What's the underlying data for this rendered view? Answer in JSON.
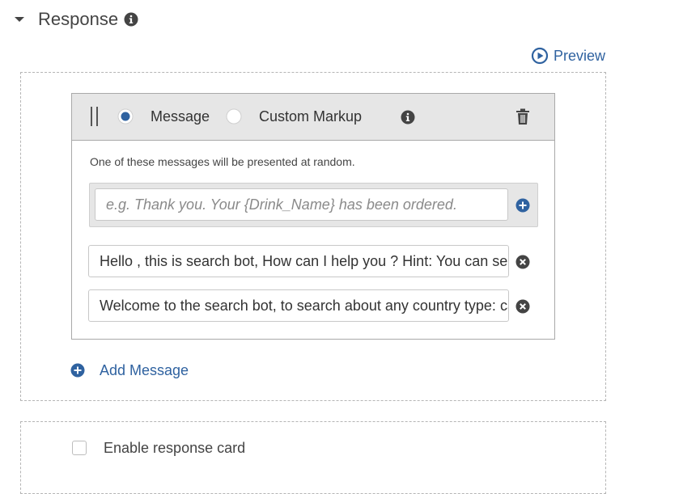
{
  "section": {
    "title": "Response",
    "preview_label": "Preview"
  },
  "panel": {
    "type_options": [
      "Message",
      "Custom Markup"
    ],
    "selected_type": "Message",
    "random_note": "One of these messages will be presented at random.",
    "new_message_placeholder": "e.g. Thank you. Your {Drink_Name} has been ordered.",
    "messages": [
      "Hello , this is search bot, How can I help you ? Hint: You can search about any country",
      "Welcome to the search bot, to search about any country type: can you search about [country]"
    ]
  },
  "add_message_label": "Add Message",
  "response_card": {
    "label": "Enable response card",
    "checked": false
  },
  "colors": {
    "accent": "#2f62a0",
    "icon_dark": "#444444",
    "panel_header_bg": "#e6e6e6"
  },
  "icons": [
    "caret-down-icon",
    "info-icon",
    "play-circle-icon",
    "drag-handle-icon",
    "trash-icon",
    "plus-circle-icon",
    "close-circle-icon"
  ]
}
